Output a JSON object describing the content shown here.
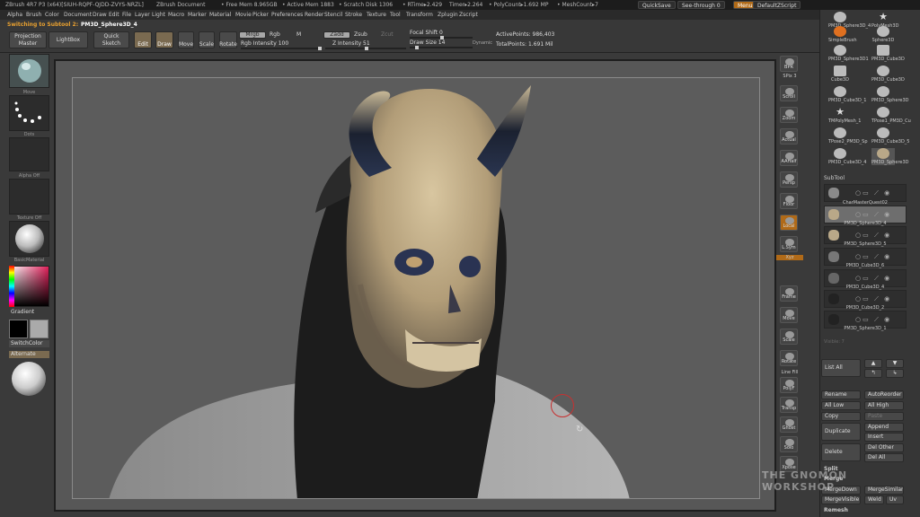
{
  "titlebar": {
    "app": "ZBrush 4R7 P3 (x64)[SIUH-RQPF-QJDD-ZVYS-NRZL]",
    "doc": "ZBrush Document",
    "free_mem": "• Free Mem 8.965GB",
    "active_mem": "• Active Mem 1883",
    "scratch": "• Scratch Disk 1306",
    "rtime": "• RTime▸2.429",
    "timer": "Timer▸2.264",
    "polycount": "• PolyCount▸1.692 MP",
    "meshcount": "• MeshCount▸7",
    "quicksave": "QuickSave",
    "seethrough": "See-through 0",
    "menus": "Menus",
    "defaultzscript": "DefaultZScript"
  },
  "menubar": [
    "Alpha",
    "Brush",
    "Color",
    "Document",
    "Draw",
    "Edit",
    "File",
    "Layer",
    "Light",
    "Macro",
    "Marker",
    "Material",
    "Movie",
    "Picker",
    "Preferences",
    "Render",
    "Stencil",
    "Stroke",
    "Texture",
    "Tool",
    "Transform",
    "Zplugin",
    "Zscript"
  ],
  "notice": {
    "text": "Switching to Subtool 2:",
    "name": "PM3D_Sphere3D_4"
  },
  "shelf": {
    "projection_master": "Projection Master",
    "lightbox": "LightBox",
    "quick_sketch": "Quick Sketch",
    "edit": "Edit",
    "draw": "Draw",
    "move": "Move",
    "scale": "Scale",
    "rotate": "Rotate",
    "mrgb": "Mrgb",
    "rgb": "Rgb",
    "m": "M",
    "rgb_intensity": "Rgb Intensity 100",
    "zadd": "Zadd",
    "zsub": "Zsub",
    "zcut": "Zcut",
    "z_intensity": "Z Intensity 51",
    "focal_shift": "Focal Shift 0",
    "draw_size": "Draw Size 14",
    "dynamic": "Dynamic",
    "active_points": "ActivePoints: 986,403",
    "total_points": "TotalPoints: 1.691 Mil"
  },
  "leftshelf": {
    "brush_label": "Move",
    "stroke_label": "Dots",
    "alpha_label": "Alpha Off",
    "texture_label": "Texture Off",
    "material_label": "BasicMaterial",
    "gradient": "Gradient",
    "switchcolor": "SwitchColor",
    "alternate": "Alternate"
  },
  "rightshelf": [
    {
      "name": "bpr",
      "label": "BPR"
    },
    {
      "name": "spix",
      "label": "SPix 3"
    },
    {
      "name": "scroll",
      "label": "Scroll"
    },
    {
      "name": "zoom",
      "label": "Zoom"
    },
    {
      "name": "actual",
      "label": "Actual"
    },
    {
      "name": "aahalf",
      "label": "AAHalf"
    },
    {
      "name": "persp",
      "label": "Persp"
    },
    {
      "name": "floor",
      "label": "Floor"
    },
    {
      "name": "local",
      "label": "Local"
    },
    {
      "name": "lsym",
      "label": "L.Sym"
    },
    {
      "name": "xyz",
      "label": "Xyz"
    },
    {
      "name": "frame",
      "label": "Frame"
    },
    {
      "name": "move",
      "label": "Move"
    },
    {
      "name": "scale",
      "label": "Scale"
    },
    {
      "name": "rotate",
      "label": "Rotate"
    },
    {
      "name": "linefill",
      "label": "Line Fill"
    },
    {
      "name": "polyf",
      "label": "PolyF"
    },
    {
      "name": "transp",
      "label": "Transp"
    },
    {
      "name": "ghost",
      "label": "Ghost"
    },
    {
      "name": "solo",
      "label": "Solo"
    },
    {
      "name": "xpose",
      "label": "Xpose"
    }
  ],
  "tools": [
    {
      "label": "PM3D_Sphere3D_4",
      "shape": "sphere"
    },
    {
      "label": "PolyMesh3D",
      "shape": "star"
    },
    {
      "label": "SimpleBrush",
      "shape": "sphere"
    },
    {
      "label": "Sphere3D",
      "shape": "sphere"
    },
    {
      "label": "PM3D_Sphere3D1",
      "shape": "sphere"
    },
    {
      "label": "PM3D_Cube3D",
      "shape": "cube"
    },
    {
      "label": "Cube3D",
      "shape": "cube"
    },
    {
      "label": "PM3D_Cube3D",
      "shape": "sphere"
    },
    {
      "label": "PM3D_Cube3D_1",
      "shape": "sphere"
    },
    {
      "label": "PM3D_Sphere3D",
      "shape": "sphere"
    },
    {
      "label": "TMPolyMesh_1",
      "shape": "star"
    },
    {
      "label": "TPose1_PM3D_Cu",
      "shape": "sphere"
    },
    {
      "label": "TPose2_PM3D_Sp",
      "shape": "sphere"
    },
    {
      "label": "PM3D_Cube3D_5",
      "shape": "sphere"
    },
    {
      "label": "PM3D_Cube3D_4",
      "shape": "sphere"
    },
    {
      "label": "PM3D_Sphere3D",
      "shape": "sphere"
    }
  ],
  "subtool": {
    "header": "SubTool",
    "items": [
      {
        "label": "CharMasterQuest02"
      },
      {
        "label": "PM3D_Sphere3D_4"
      },
      {
        "label": "PM3D_Sphere3D_5"
      },
      {
        "label": "PM3D_Cube3D_6"
      },
      {
        "label": "PM3D_Cube3D_4"
      },
      {
        "label": "PM3D_Cube3D_2"
      },
      {
        "label": "PM3D_Sphere3D_1"
      }
    ],
    "visible": "Visible: 7",
    "list_all": "List All",
    "rename": "Rename",
    "autoreorder": "AutoReorder",
    "all_low": "All Low",
    "all_high": "All High",
    "copy": "Copy",
    "paste": "Paste",
    "duplicate": "Duplicate",
    "append": "Append",
    "insert": "Insert",
    "delete": "Delete",
    "del_other": "Del Other",
    "del_all": "Del All",
    "split": "Split",
    "merge": "Merge",
    "mergedown": "MergeDown",
    "mergesimilar": "MergeSimilar",
    "mergevisible": "MergeVisible",
    "weld": "Weld",
    "uv": "Uv",
    "remesh": "Remesh"
  },
  "watermark": "THE GNOMON WORKSHOP"
}
